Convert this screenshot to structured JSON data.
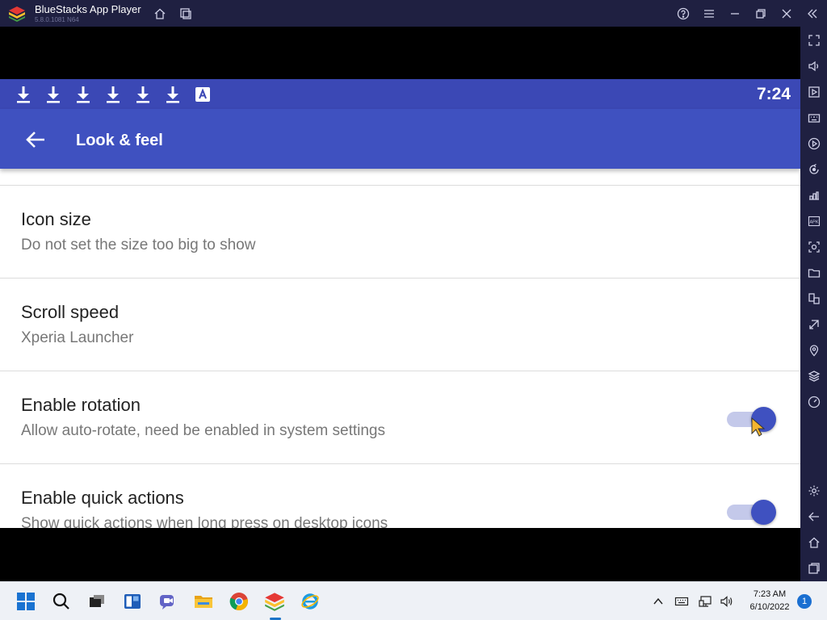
{
  "window": {
    "title": "BlueStacks App Player",
    "version": "5.8.0.1081 N64"
  },
  "android": {
    "status_time": "7:24",
    "appbar_title": "Look & feel",
    "preferences": [
      {
        "title": "Icon size",
        "summary": "Do not set the size too big to show",
        "toggle": null
      },
      {
        "title": "Scroll speed",
        "summary": "Xperia Launcher",
        "toggle": null
      },
      {
        "title": "Enable rotation",
        "summary": "Allow auto-rotate, need be enabled in system settings",
        "toggle": true
      },
      {
        "title": "Enable quick actions",
        "summary": "Show quick actions when long press on desktop icons",
        "toggle": true
      }
    ]
  },
  "taskbar": {
    "time": "7:23 AM",
    "date": "6/10/2022",
    "notification_count": "1"
  },
  "colors": {
    "titlebar": "#1f2041",
    "statusbar": "#3b48b5",
    "appbar": "#3f51c0",
    "toggle_track": "#c4c9ea"
  }
}
